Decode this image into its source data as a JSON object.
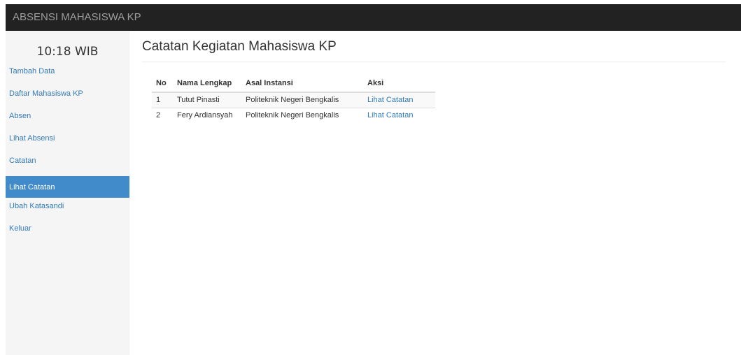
{
  "navbar": {
    "brand": "ABSENSI MAHASISWA KP"
  },
  "sidebar": {
    "clock": "10:18 WIB",
    "items": [
      {
        "label": "Tambah Data"
      },
      {
        "label": "Daftar Mahasiswa KP"
      },
      {
        "label": "Absen"
      },
      {
        "label": "Lihat Absensi"
      },
      {
        "label": "Catatan"
      },
      {
        "label": "Lihat Catatan"
      },
      {
        "label": "Ubah Katasandi"
      },
      {
        "label": "Keluar"
      }
    ],
    "active_index": 5
  },
  "main": {
    "title": "Catatan Kegiatan Mahasiswa KP",
    "table": {
      "headers": [
        "No",
        "Nama Lengkap",
        "Asal Instansi",
        "Aksi"
      ],
      "rows": [
        {
          "no": "1",
          "nama": "Tutut Pinasti",
          "asal": "Politeknik Negeri Bengkalis",
          "aksi": "Lihat Catatan"
        },
        {
          "no": "2",
          "nama": "Fery Ardiansyah",
          "asal": "Politeknik Negeri Bengkalis",
          "aksi": "Lihat Catatan"
        }
      ]
    }
  },
  "colors": {
    "navbar_bg": "#222222",
    "sidebar_bg": "#f5f5f5",
    "active_bg": "#428bca",
    "link": "#337ab7"
  }
}
